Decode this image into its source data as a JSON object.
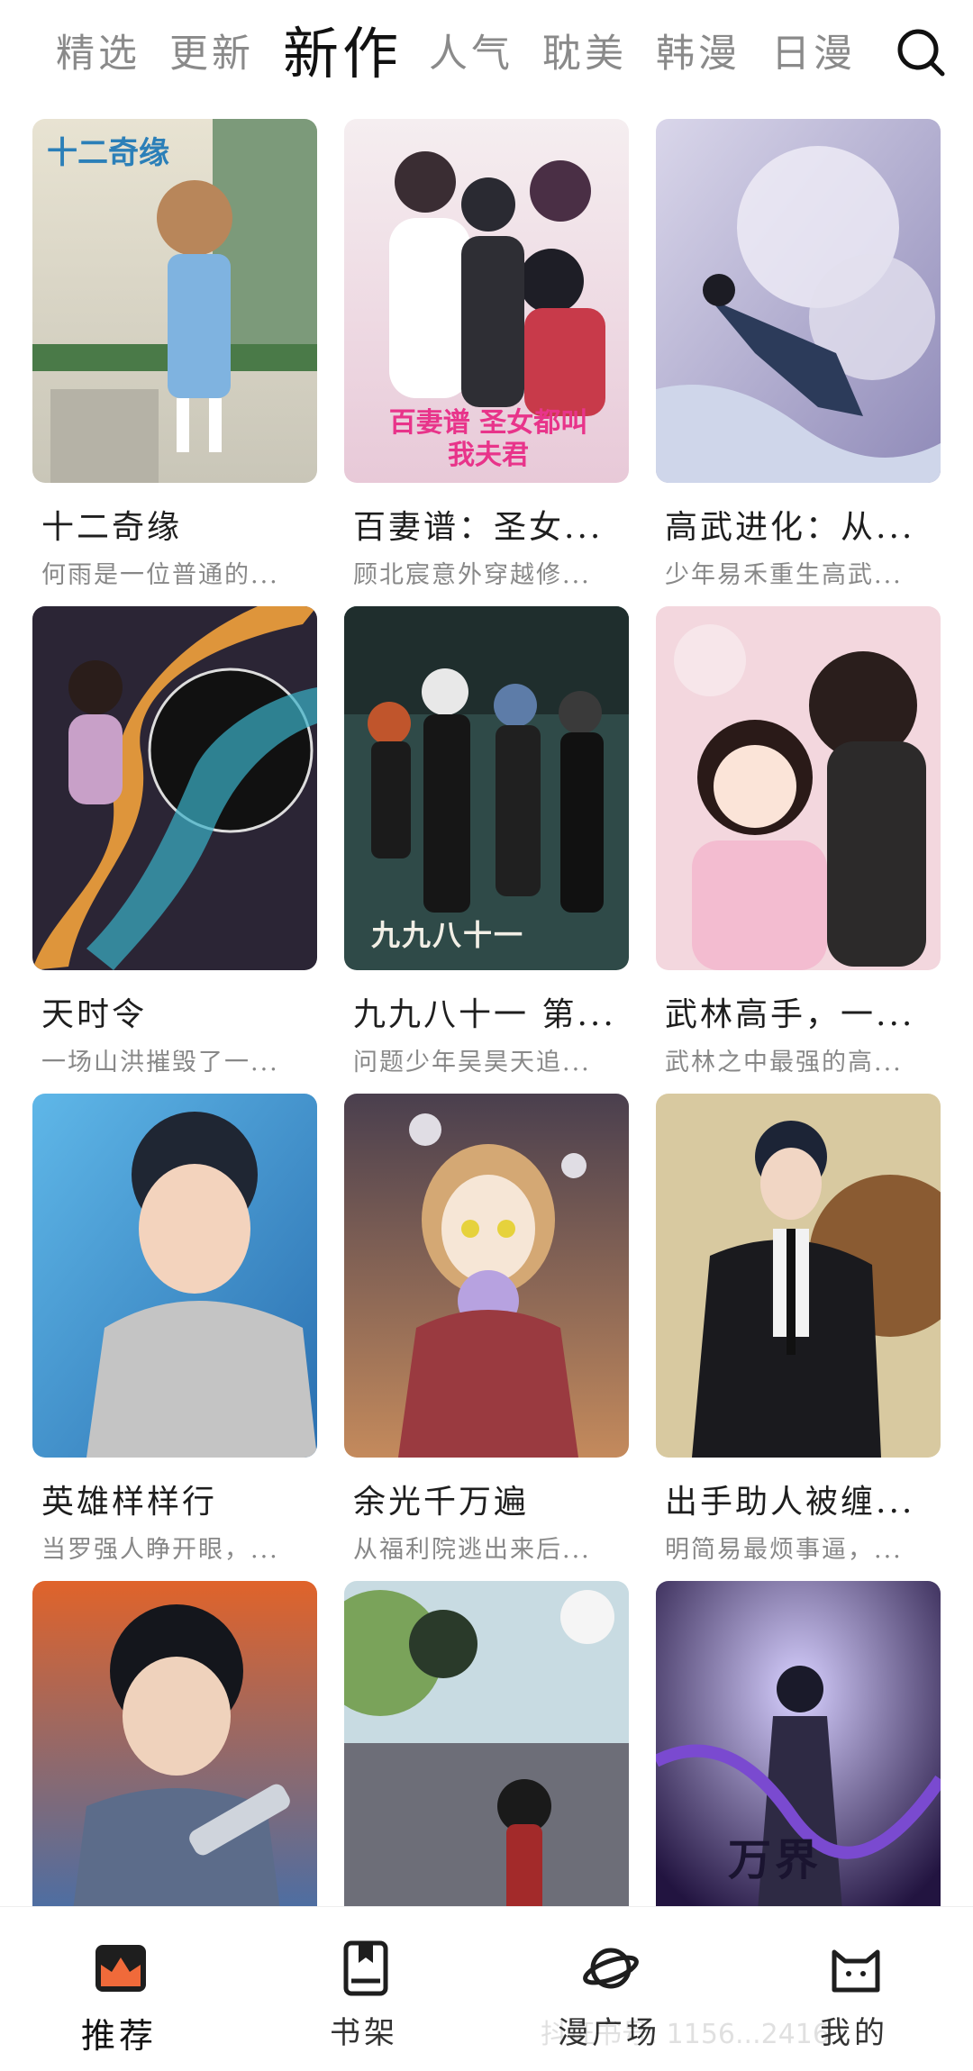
{
  "tabs": [
    {
      "label": "精选",
      "active": false
    },
    {
      "label": "更新",
      "active": false
    },
    {
      "label": "新作",
      "active": true
    },
    {
      "label": "人气",
      "active": false
    },
    {
      "label": "耽美",
      "active": false
    },
    {
      "label": "韩漫",
      "active": false
    },
    {
      "label": "日漫",
      "active": false
    }
  ],
  "search_icon": "search-icon",
  "comics": [
    {
      "title": "十二奇缘",
      "desc": "何雨是一位普通的...",
      "cover_text": "十二奇缘"
    },
    {
      "title": "百妻谱：圣女...",
      "desc": "顾北宸意外穿越修...",
      "cover_text": "百妻谱 圣女都叫我夫君"
    },
    {
      "title": "高武进化：从...",
      "desc": "少年易禾重生高武...",
      "cover_text": ""
    },
    {
      "title": "天时令",
      "desc": "一场山洪摧毁了一...",
      "cover_text": ""
    },
    {
      "title": "九九八十一 第...",
      "desc": "问题少年吴昊天追...",
      "cover_text": "九九八十一"
    },
    {
      "title": "武林高手，一...",
      "desc": "武林之中最强的高...",
      "cover_text": ""
    },
    {
      "title": "英雄样样行",
      "desc": "当罗强人睁开眼，...",
      "cover_text": ""
    },
    {
      "title": "余光千万遍",
      "desc": "从福利院逃出来后...",
      "cover_text": ""
    },
    {
      "title": "出手助人被缠...",
      "desc": "明简易最烦事逼，...",
      "cover_text": ""
    },
    {
      "title": "",
      "desc": "",
      "cover_text": ""
    },
    {
      "title": "",
      "desc": "",
      "cover_text": ""
    },
    {
      "title": "",
      "desc": "",
      "cover_text": "万界"
    }
  ],
  "nav": [
    {
      "label": "推荐",
      "icon": "recommend-icon",
      "active": true
    },
    {
      "label": "书架",
      "icon": "bookshelf-icon",
      "active": false
    },
    {
      "label": "漫广场",
      "icon": "planet-icon",
      "active": false
    },
    {
      "label": "我的",
      "icon": "cat-face-icon",
      "active": false
    }
  ],
  "watermark": "抖证书号: 1156...2416",
  "colors": {
    "active_tab": "#111111",
    "inactive_tab": "#8a8a8a",
    "nav_accent": "#f06a3a"
  }
}
